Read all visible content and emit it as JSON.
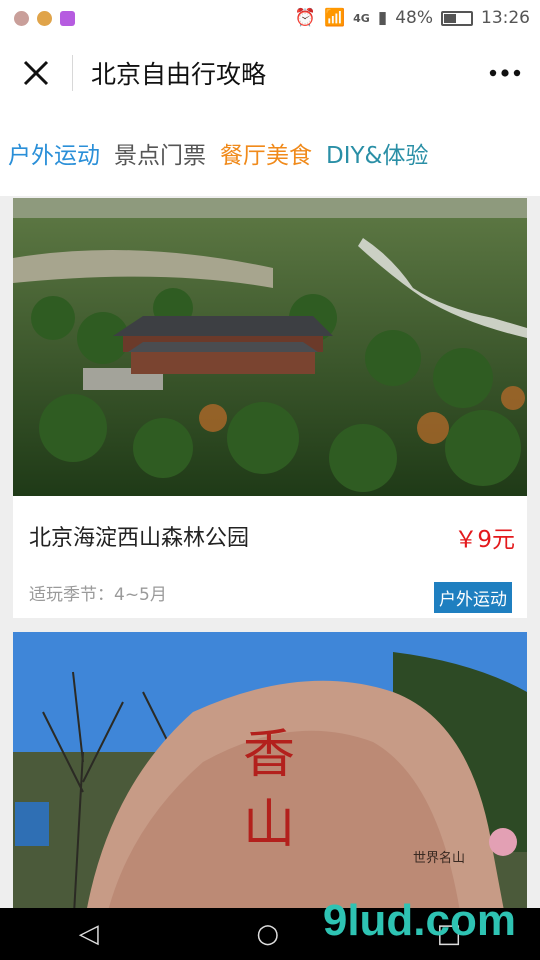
{
  "status": {
    "battery": "48%",
    "time": "13:26",
    "network": "4G"
  },
  "nav": {
    "title": "北京自由行攻略",
    "close_icon": "close-icon",
    "more_icon": "more-icon"
  },
  "tabs": [
    {
      "label": "户外运动",
      "color": "#2a8fd8"
    },
    {
      "label": "景点门票",
      "color": "#555555"
    },
    {
      "label": "餐厅美食",
      "color": "#f08a1b"
    },
    {
      "label": "DIY&体验",
      "color": "#2a8fa6"
    }
  ],
  "cards": [
    {
      "title": "北京海淀西山森林公园",
      "price": "￥9元",
      "season": "适玩季节：4~5月",
      "tag": "户外运动"
    }
  ],
  "watermark": "9lud.com"
}
